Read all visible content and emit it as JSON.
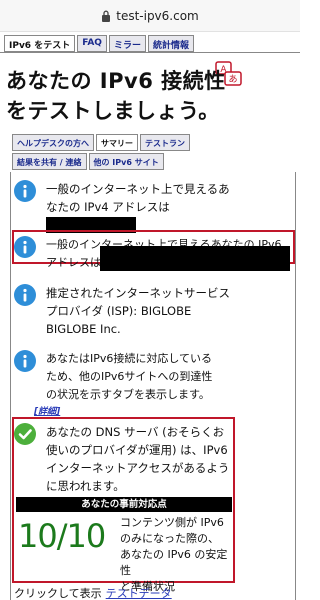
{
  "browser": {
    "url": "test-ipv6.com"
  },
  "topnav": {
    "tabs": [
      {
        "label": "IPv6 をテスト",
        "active": true
      },
      {
        "label": "FAQ",
        "active": false
      },
      {
        "label": "ミラー",
        "active": false
      },
      {
        "label": "統計情報",
        "active": false
      }
    ]
  },
  "headline": {
    "line1": "あなたの IPv6 接続性",
    "line2": "をテストしましょう。"
  },
  "subnav": {
    "row1": [
      {
        "label": "ヘルプデスクの方へ",
        "active": false
      },
      {
        "label": "サマリー",
        "active": true
      },
      {
        "label": "テストラン",
        "active": false
      }
    ],
    "row2": [
      {
        "label": "結果を共有 / 連絡",
        "active": false
      },
      {
        "label": "他の IPv6 サイト",
        "active": false
      }
    ]
  },
  "results": {
    "ipv4": {
      "line1": "一般のインターネット上で見えるあ",
      "line2": "なたの IPv4 アドレスは"
    },
    "ipv6": {
      "line1": "一般のインターネット上で見えるあなたの IPv6",
      "line2": "アドレスは"
    },
    "isp": {
      "line1": "推定されたインターネットサービス",
      "line2": "プロバイダ (ISP): BIGLOBE",
      "line3": "BIGLOBE Inc."
    },
    "tab_notice": {
      "line1": "あなたはIPv6接続に対応している",
      "line2": "ため、他のIPv6サイトへの到達性",
      "line3": "の状況を示すタブを表示します。",
      "detail_link": "[詳細]"
    },
    "dns": {
      "line1": "あなたの DNS サーバ (おそらくお",
      "line2": "使いのプロバイダが運用) は、IPv6",
      "line3": "インターネットアクセスがあるよう",
      "line4": "に思われます。"
    }
  },
  "readiness": {
    "banner": "あなたの事前対応点",
    "score": "10/10",
    "desc_line1": "コンテンツ側が IPv6",
    "desc_line2": "のみになった際の、",
    "desc_line3": "あなたの IPv6 の安定性",
    "desc_line4": "と準備状況"
  },
  "footer": {
    "text": "クリックして表示",
    "link": "テストデータ"
  },
  "colors": {
    "info_blue": "#2e8ed8",
    "check_green": "#4caf3b",
    "highlight_red": "#c0172a",
    "score_green": "#1c7a1c",
    "link_blue": "#2a3cb8"
  },
  "icons": {
    "info": "info-icon",
    "check": "check-icon",
    "translate": "translate-icon",
    "lock": "lock-icon"
  }
}
